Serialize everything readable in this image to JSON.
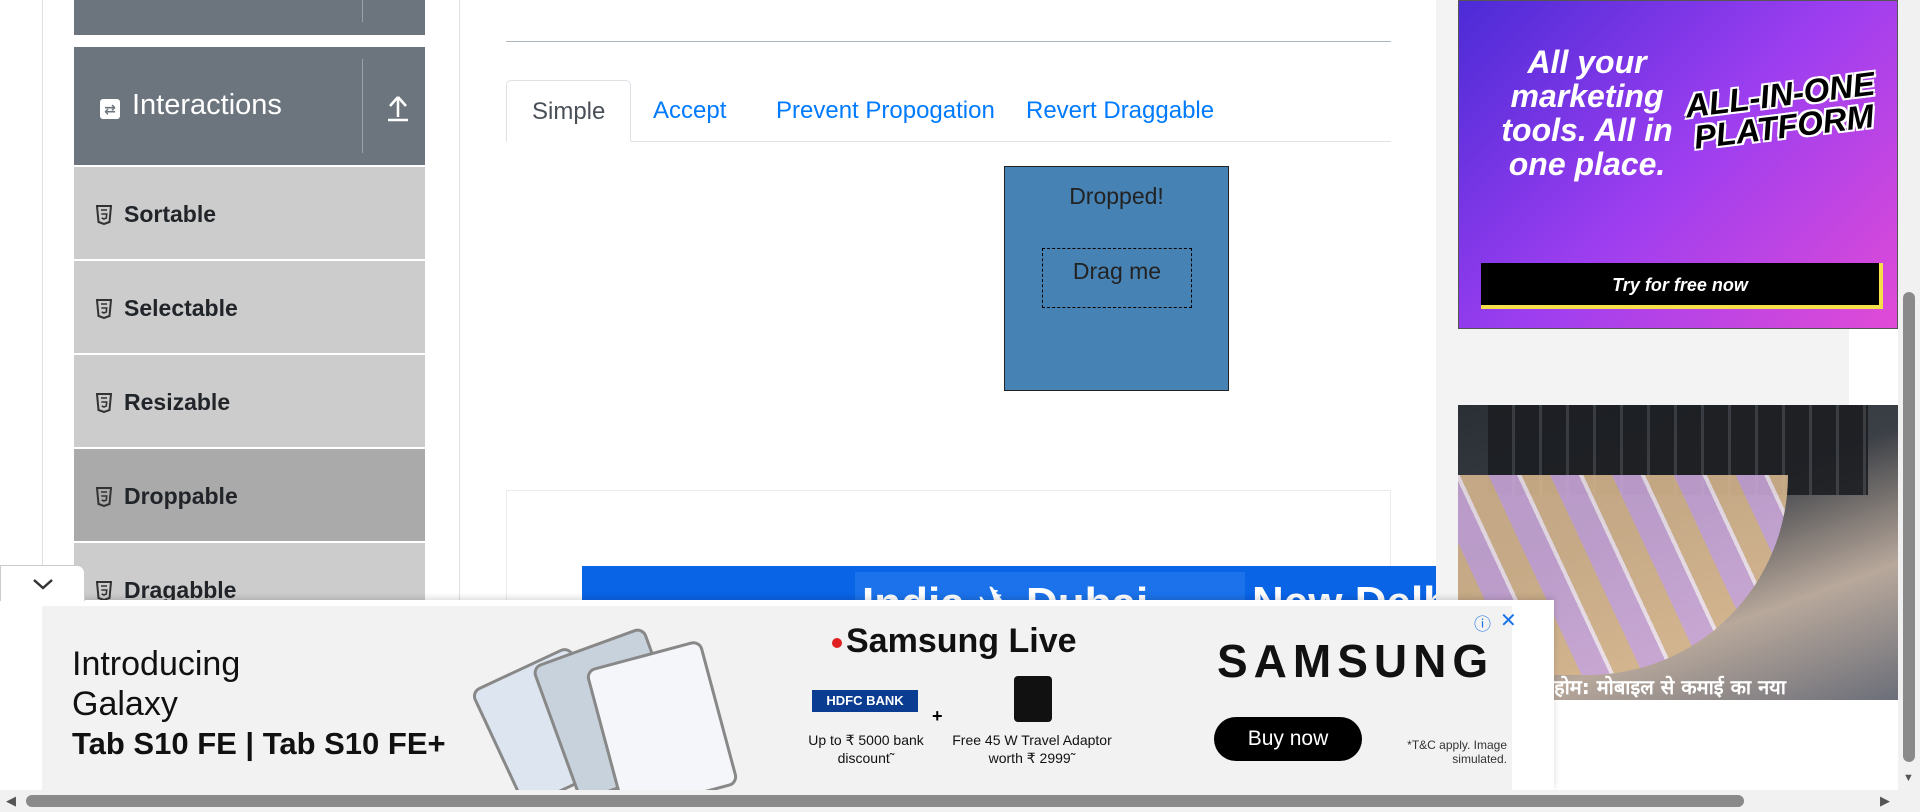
{
  "sidebar": {
    "group_title": "Interactions",
    "items": [
      {
        "label": "Sortable"
      },
      {
        "label": "Selectable"
      },
      {
        "label": "Resizable"
      },
      {
        "label": "Droppable"
      },
      {
        "label": "Dragabble"
      }
    ]
  },
  "main": {
    "tabs": [
      {
        "label": "Simple"
      },
      {
        "label": "Accept"
      },
      {
        "label": "Prevent Propogation"
      },
      {
        "label": "Revert Draggable"
      }
    ],
    "drop_label": "Dropped!",
    "drag_label": "Drag me",
    "drop_color": "#4682b4"
  },
  "ads": {
    "promo": {
      "text": "All your marketing tools. All in one place.",
      "badge": "ALL-IN-ONE PLATFORM",
      "button": "Try for free now"
    },
    "flight": {
      "route1": "India ✈ Dubai",
      "route2": "New Delh"
    },
    "money_caption": "होम: मोबाइल से कमाई का नया",
    "samsung": {
      "intro_line1": "Introducing",
      "intro_line2": "Galaxy",
      "intro_line3": "Tab S10 FE | Tab S10 FE+",
      "live": "Samsung Live",
      "bank": "HDFC BANK",
      "plus": "+",
      "offer1": "Up to ₹ 5000 bank discount˜",
      "offer2": "Free 45 W Travel Adaptor worth ₹ 2999˜",
      "brand": "SAMSUNG",
      "buy": "Buy now",
      "tnc": "*T&C apply. Image simulated."
    }
  }
}
